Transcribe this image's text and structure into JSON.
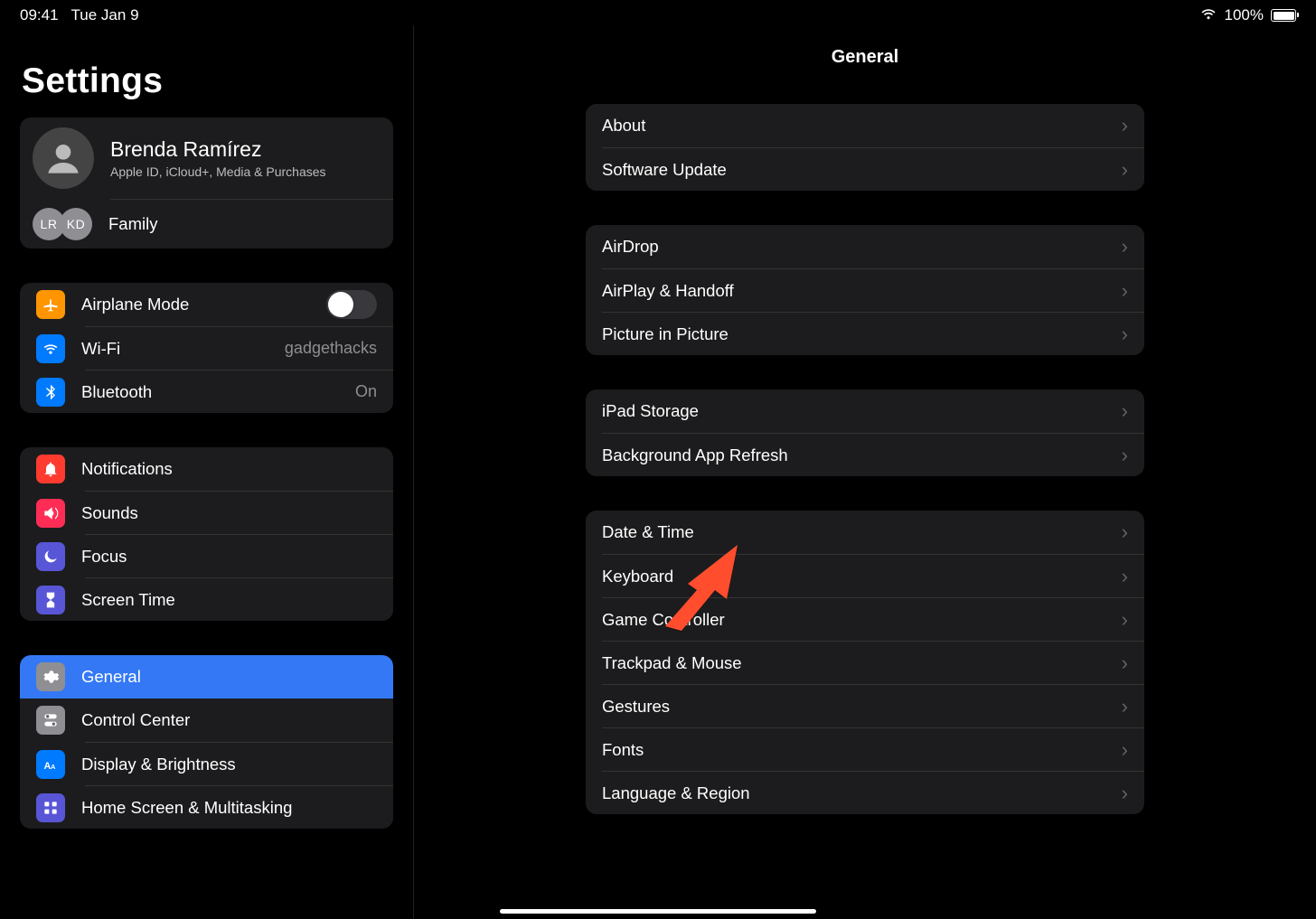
{
  "status": {
    "time": "09:41",
    "date": "Tue Jan 9",
    "battery_pct": "100%"
  },
  "sidebar": {
    "title": "Settings",
    "account": {
      "name": "Brenda Ramírez",
      "sub": "Apple ID, iCloud+, Media & Purchases"
    },
    "family": {
      "label": "Family",
      "badges": [
        "LR",
        "KD"
      ]
    },
    "g1": {
      "airplane": "Airplane Mode",
      "wifi": "Wi-Fi",
      "wifi_value": "gadgethacks",
      "bt": "Bluetooth",
      "bt_value": "On"
    },
    "g2": {
      "notif": "Notifications",
      "sounds": "Sounds",
      "focus": "Focus",
      "screentime": "Screen Time"
    },
    "g3": {
      "general": "General",
      "control": "Control Center",
      "display": "Display & Brightness",
      "home": "Home Screen & Multitasking"
    }
  },
  "main": {
    "title": "General",
    "g1": [
      "About",
      "Software Update"
    ],
    "g2": [
      "AirDrop",
      "AirPlay & Handoff",
      "Picture in Picture"
    ],
    "g3": [
      "iPad Storage",
      "Background App Refresh"
    ],
    "g4": [
      "Date & Time",
      "Keyboard",
      "Game Controller",
      "Trackpad & Mouse",
      "Gestures",
      "Fonts",
      "Language & Region"
    ]
  }
}
